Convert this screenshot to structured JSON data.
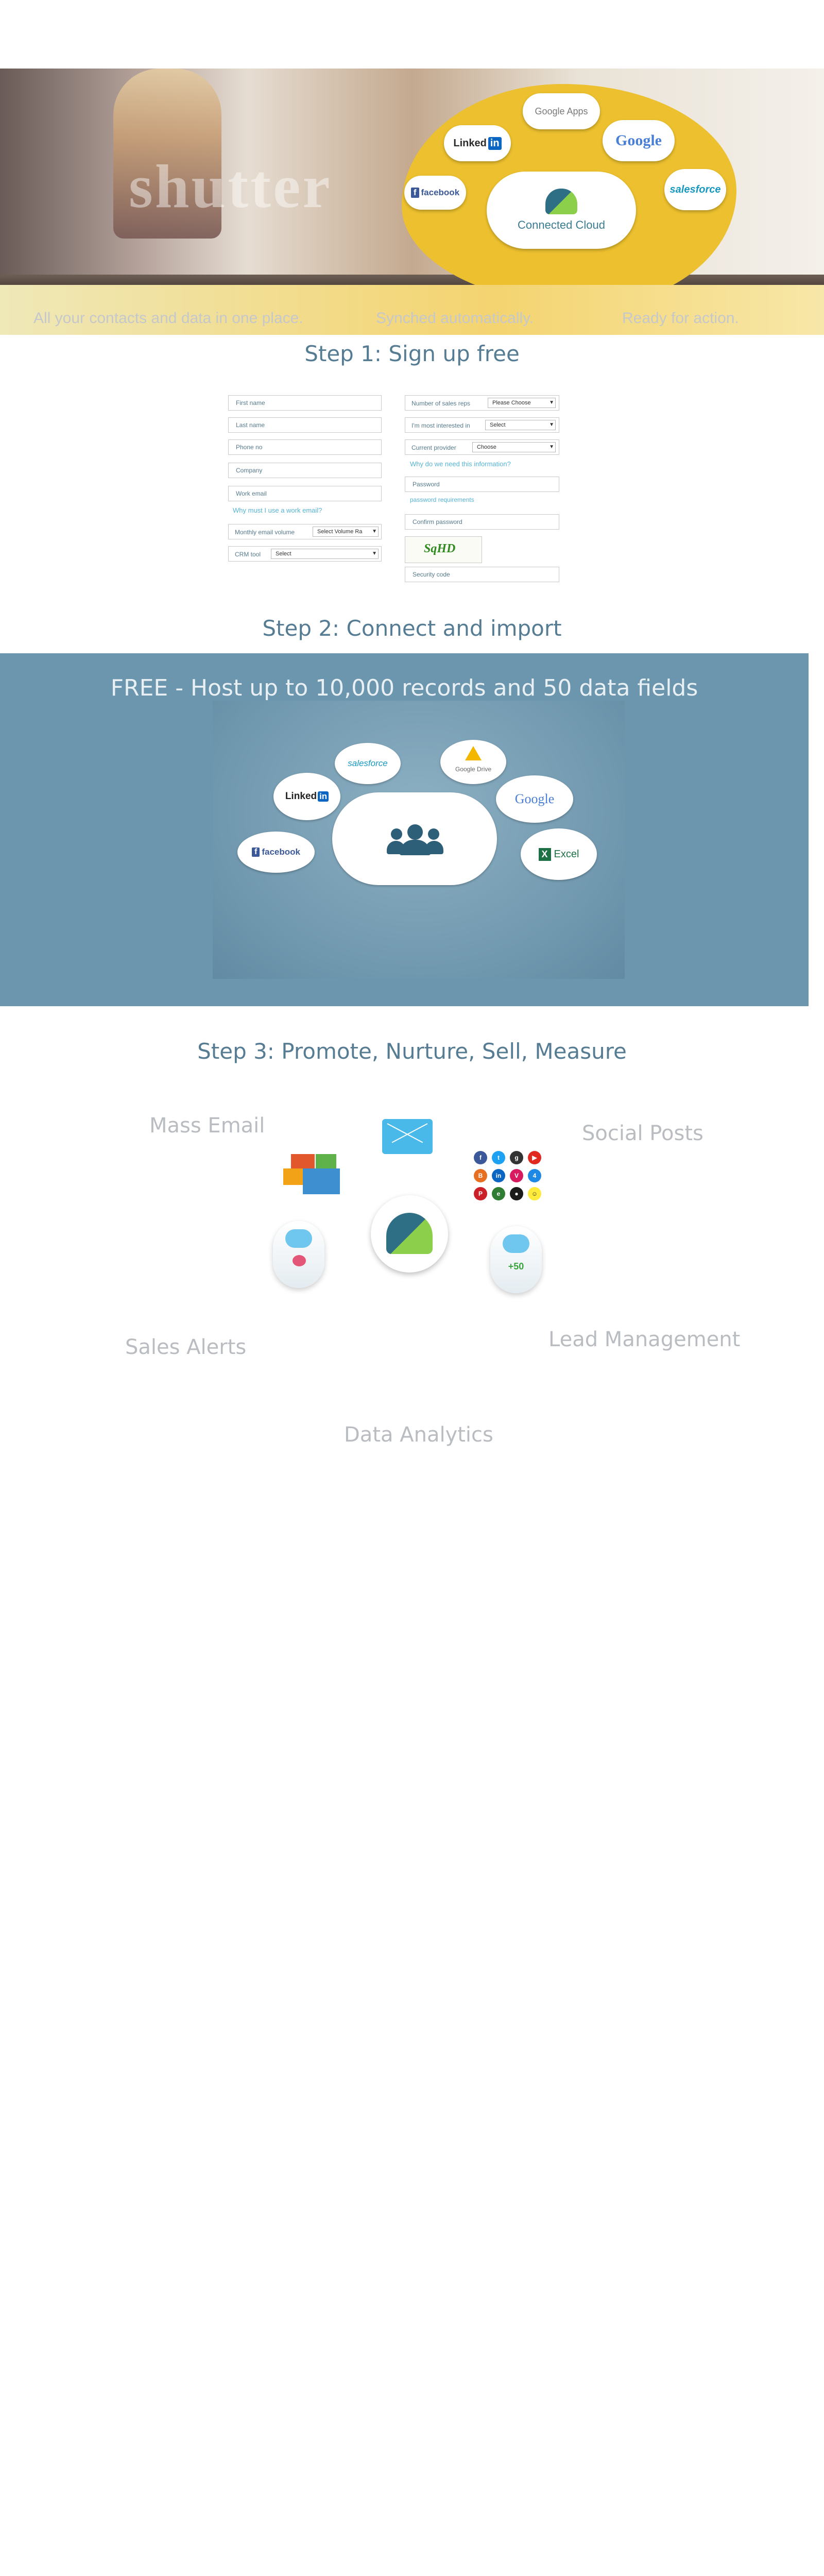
{
  "hero": {
    "watermark": "shutter",
    "cloud_title": "Connected Cloud",
    "brands": {
      "linkedin": "Linked",
      "linkedin_in": "in",
      "facebook": "facebook",
      "google_apps": "Google Apps",
      "google": "Google",
      "salesforce": "salesforce"
    },
    "taglines": [
      "All your contacts and data  in one place.",
      "Synched automatically.",
      "Ready for action."
    ]
  },
  "step1": {
    "title": "Step 1: Sign up free",
    "fields": {
      "first_name": "First name",
      "last_name": "Last name",
      "phone": "Phone no",
      "company": "Company",
      "work_email": "Work email",
      "why_work_email": "Why must I use a work email?",
      "monthly_email_volume": "Monthly email volume",
      "monthly_email_volume_value": "Select Volume Ra",
      "crm_tool": "CRM tool",
      "crm_tool_value": "Select",
      "number_of_sales_reps": "Number of sales reps",
      "number_of_sales_reps_value": "Please Choose",
      "most_interested_in": "I'm most interested in",
      "most_interested_in_value": "Select",
      "current_provider": "Current provider",
      "current_provider_value": "Choose",
      "why_need_info": "Why do we need this information?",
      "password": "Password",
      "password_requirements": "password requirements",
      "confirm_password": "Confirm password",
      "captcha": "SqHD",
      "security_code": "Security code"
    }
  },
  "step2": {
    "title": "Step 2: Connect and import",
    "free_text": "FREE - Host up to 10,000 records and 50 data fields",
    "sources": {
      "salesforce": "salesforce",
      "google_drive": "Google Drive",
      "linkedin": "Linked",
      "linkedin_in": "in",
      "google": "Google",
      "facebook": "facebook",
      "excel": "Excel"
    }
  },
  "step3": {
    "title": "Step 3: Promote, Nurture, Sell, Measure",
    "labels": {
      "mass_email": "Mass Email",
      "social_posts": "Social Posts",
      "sales_alerts": "Sales Alerts",
      "lead_management": "Lead Management",
      "data_analytics": "Data Analytics"
    },
    "badge": "+50"
  },
  "colors": {
    "step_title": "#567c94",
    "step2_band": "#6c96ae",
    "hero_yellow": "#ecc02e",
    "faded_label": "#b9bcc0",
    "link": "#55b4d6"
  },
  "icons": [
    "envelope-icon",
    "people-icon",
    "excel-icon",
    "google-drive-icon",
    "facebook-icon",
    "twitter-icon",
    "youtube-icon",
    "linkedin-icon",
    "pinterest-icon",
    "robot-icon"
  ]
}
